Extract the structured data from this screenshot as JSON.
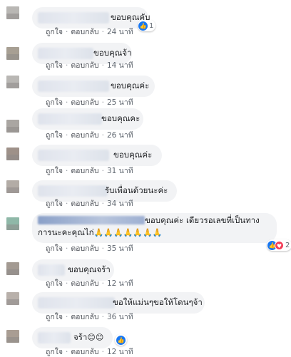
{
  "actions": {
    "like": "ถูกใจ",
    "reply": "ตอบกลับ"
  },
  "comments": [
    {
      "text": "ขอบคุณคับ",
      "time": "24 นาที",
      "reaction_count": "1"
    },
    {
      "text": "ขอบคุณจ้า",
      "time": "14 นาที"
    },
    {
      "text": "ขอบคุณค่ะ",
      "time": "25 นาที"
    },
    {
      "text": "ขอบคุณคะ",
      "time": "26 นาที"
    },
    {
      "text": "ขอบคุณค่ะ",
      "time": "31 นาที"
    },
    {
      "text": "รับเพื่อนด้วยนะค่ะ",
      "time": "34 นาที"
    },
    {
      "name_partial": "ไพบูลย์ ศุภวรรณ ประสุรุปหา",
      "text_line1": "ขอบคุณค่ะ เดียวรอเลขที่เป็นทาง",
      "text_line2": "การนะคะคุณไก่",
      "emojis": "🙏🙏🙏🙏🙏🙏🙏",
      "time": "35 นาที",
      "reaction_count": "2"
    },
    {
      "text": "ขอบคุณจร้า",
      "time": "12 นาที"
    },
    {
      "text": "ขอให้แม่นๆขอให้โดนๆจ้า",
      "time": "36 นาที"
    },
    {
      "text": "จร้า",
      "emojis": "😊😊",
      "time": "12 นาที"
    }
  ],
  "icons": {
    "like": "thumbs-up-icon",
    "love": "heart-icon"
  },
  "colors": {
    "like_blue": "#1877f2",
    "love_red": "#f33e58",
    "bubble": "#f2f3f5",
    "meta": "#606770"
  }
}
